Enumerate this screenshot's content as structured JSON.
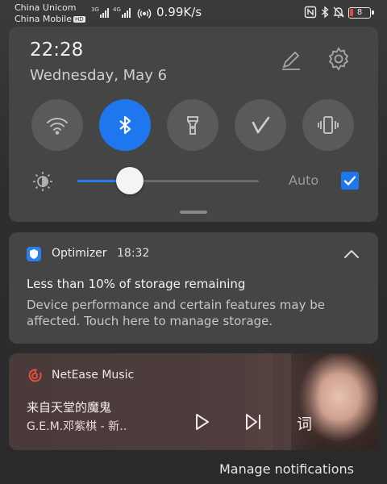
{
  "status_bar": {
    "carrier_1": "China Unicom",
    "carrier_2": "China Mobile",
    "hd_badge": "HD",
    "signal_1_tag": "3G",
    "signal_2_tag": "4G",
    "net_speed": "0.99K/s",
    "battery_level": "8",
    "icons": [
      "hotspot-icon",
      "nfc-icon",
      "bluetooth-icon",
      "mute-bell-icon",
      "battery-icon"
    ]
  },
  "quick_settings": {
    "time": "22:28",
    "date": "Wednesday, May 6",
    "tiles": [
      {
        "icon": "wifi-icon",
        "active": false
      },
      {
        "icon": "bluetooth-icon",
        "active": true
      },
      {
        "icon": "flashlight-icon",
        "active": false
      },
      {
        "icon": "vpn-icon",
        "active": false
      },
      {
        "icon": "vibrate-icon",
        "active": false
      }
    ],
    "brightness_level": 0.29,
    "auto_label": "Auto",
    "auto_checked": true,
    "accent_color": "#1f77f0"
  },
  "optimizer_notification": {
    "app_name": "Optimizer",
    "time": "18:32",
    "title": "Less than 10% of storage remaining",
    "body": "Device performance and certain features may be affected. Touch here to manage storage."
  },
  "music_notification": {
    "app_name": "NetEase Music",
    "song_title": "来自天堂的魔鬼",
    "artist": "G.E.M.邓紫棋 - 新‥",
    "lyrics_button": "词"
  },
  "footer": {
    "manage_notifications": "Manage notifications"
  }
}
